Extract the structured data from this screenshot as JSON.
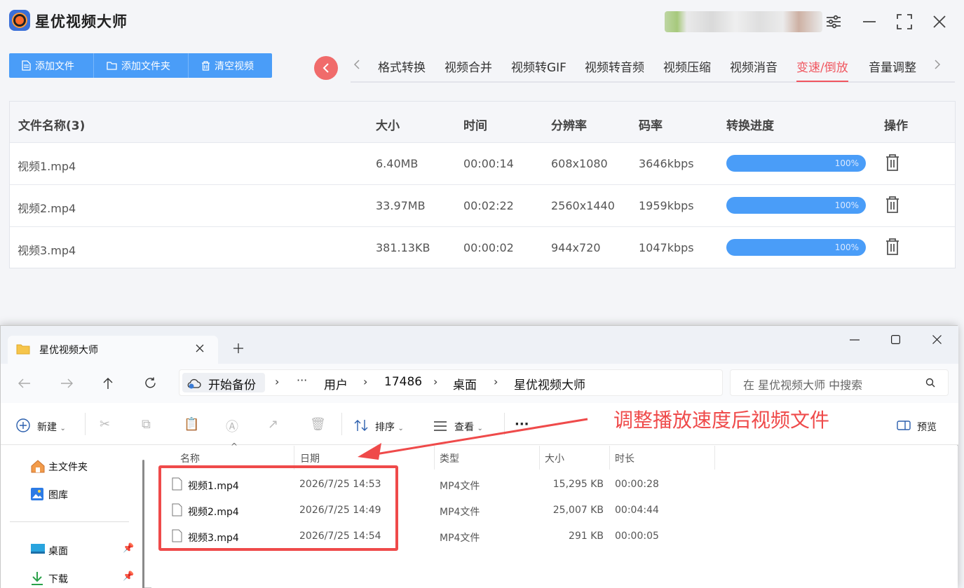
{
  "app": {
    "title": "星优视频大师",
    "window_controls": [
      "settings-sliders",
      "minimize",
      "maximize",
      "close"
    ]
  },
  "toolbar": {
    "add_file": "添加文件",
    "add_folder": "添加文件夹",
    "clear": "清空视频"
  },
  "tabs": [
    "格式转换",
    "视频合并",
    "视频转GIF",
    "视频转音频",
    "视频压缩",
    "视频消音",
    "变速/倒放",
    "音量调整"
  ],
  "active_tab": "变速/倒放",
  "accent_color": "#f0565f",
  "progress_color": "#4a9df8",
  "table": {
    "headers": {
      "name": "文件名称(3)",
      "size": "大小",
      "time": "时间",
      "resolution": "分辨率",
      "bitrate": "码率",
      "progress": "转换进度",
      "action": "操作"
    },
    "rows": [
      {
        "name": "视频1.mp4",
        "size": "6.40MB",
        "time": "00:00:14",
        "resolution": "608x1080",
        "bitrate": "3646kbps",
        "progress": "100%"
      },
      {
        "name": "视频2.mp4",
        "size": "33.97MB",
        "time": "00:02:22",
        "resolution": "2560x1440",
        "bitrate": "1959kbps",
        "progress": "100%"
      },
      {
        "name": "视频3.mp4",
        "size": "381.13KB",
        "time": "00:00:02",
        "resolution": "944x720",
        "bitrate": "1047kbps",
        "progress": "100%"
      }
    ]
  },
  "explorer": {
    "tab_title": "星优视频大师",
    "breadcrumb": [
      "开始备份",
      "···",
      "用户",
      "17486",
      "桌面",
      "星优视频大师"
    ],
    "search_placeholder": "在 星优视频大师 中搜索",
    "commands": {
      "new": "新建",
      "sort": "排序",
      "view": "查看",
      "more": "···",
      "preview": "预览"
    },
    "nav": {
      "home": "主文件夹",
      "gallery": "图库",
      "desktop": "桌面",
      "downloads": "下载"
    },
    "columns": {
      "name": "名称",
      "date": "日期",
      "type": "类型",
      "size": "大小",
      "duration": "时长"
    },
    "files": [
      {
        "name": "视频1.mp4",
        "date": "2026/7/25 14:53",
        "type": "MP4文件",
        "size": "15,295 KB",
        "duration": "00:00:28"
      },
      {
        "name": "视频2.mp4",
        "date": "2026/7/25 14:49",
        "type": "MP4文件",
        "size": "25,007 KB",
        "duration": "00:04:44"
      },
      {
        "name": "视频3.mp4",
        "date": "2026/7/25 14:54",
        "type": "MP4文件",
        "size": "291 KB",
        "duration": "00:00:05"
      }
    ]
  },
  "annotation": {
    "text": "调整播放速度后视频文件",
    "color": "#ef4a4a"
  }
}
